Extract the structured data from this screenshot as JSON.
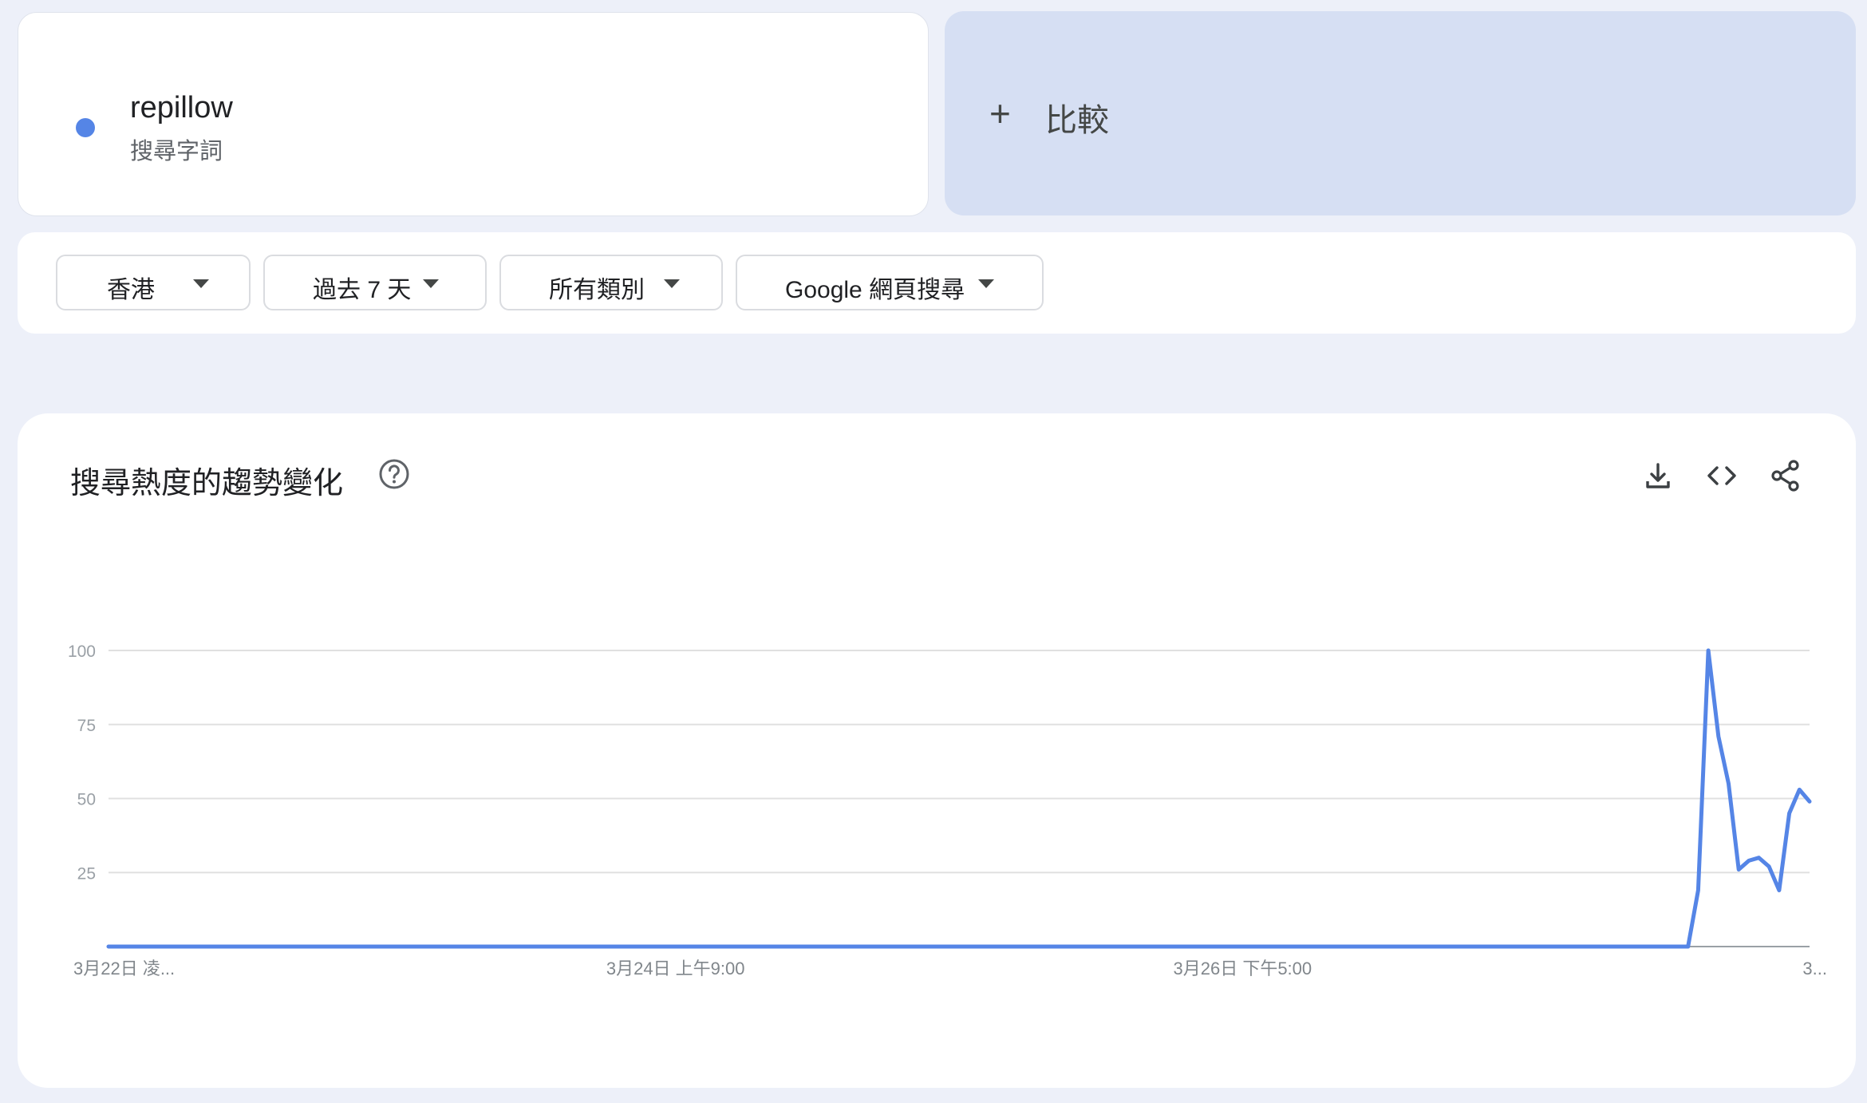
{
  "term": {
    "name": "repillow",
    "type": "搜尋字詞",
    "color": "#5585e6"
  },
  "compare": {
    "plus": "+",
    "label": "比較"
  },
  "filters": [
    {
      "label": "香港"
    },
    {
      "label": "過去 7 天"
    },
    {
      "label": "所有類別"
    },
    {
      "label": "Google 網頁搜尋"
    }
  ],
  "chart": {
    "title": "搜尋熱度的趨勢變化",
    "icons": [
      "help-icon",
      "download-icon",
      "embed-code-icon",
      "share-icon"
    ]
  },
  "chart_data": {
    "type": "line",
    "ylim": [
      0,
      100
    ],
    "y_ticks": [
      "100",
      "75",
      "50",
      "25"
    ],
    "x_tick_labels": [
      "3月22日 凌...",
      "3月24日 上午9:00",
      "3月26日 下午5:00",
      "3..."
    ],
    "grid": true,
    "series": [
      {
        "color": "#5585e6",
        "values": [
          0,
          0,
          0,
          0,
          0,
          0,
          0,
          0,
          0,
          0,
          0,
          0,
          0,
          0,
          0,
          0,
          0,
          0,
          0,
          0,
          0,
          0,
          0,
          0,
          0,
          0,
          0,
          0,
          0,
          0,
          0,
          0,
          0,
          0,
          0,
          0,
          0,
          0,
          0,
          0,
          0,
          0,
          0,
          0,
          0,
          0,
          0,
          0,
          0,
          0,
          0,
          0,
          0,
          0,
          0,
          0,
          0,
          0,
          0,
          0,
          0,
          0,
          0,
          0,
          0,
          0,
          0,
          0,
          0,
          0,
          0,
          0,
          0,
          0,
          0,
          0,
          0,
          0,
          0,
          0,
          0,
          0,
          0,
          0,
          0,
          0,
          0,
          0,
          0,
          0,
          0,
          0,
          0,
          0,
          0,
          0,
          0,
          0,
          0,
          0,
          0,
          0,
          0,
          0,
          0,
          0,
          0,
          0,
          0,
          0,
          0,
          0,
          0,
          0,
          0,
          0,
          0,
          0,
          0,
          0,
          0,
          0,
          0,
          0,
          0,
          0,
          0,
          0,
          0,
          0,
          0,
          0,
          0,
          0,
          0,
          0,
          0,
          0,
          0,
          0,
          0,
          0,
          0,
          0,
          0,
          0,
          0,
          0,
          0,
          0,
          0,
          0,
          0,
          0,
          0,
          0,
          0,
          19,
          100,
          71,
          55,
          26,
          29,
          30,
          27,
          19,
          45,
          53,
          49
        ]
      }
    ]
  }
}
